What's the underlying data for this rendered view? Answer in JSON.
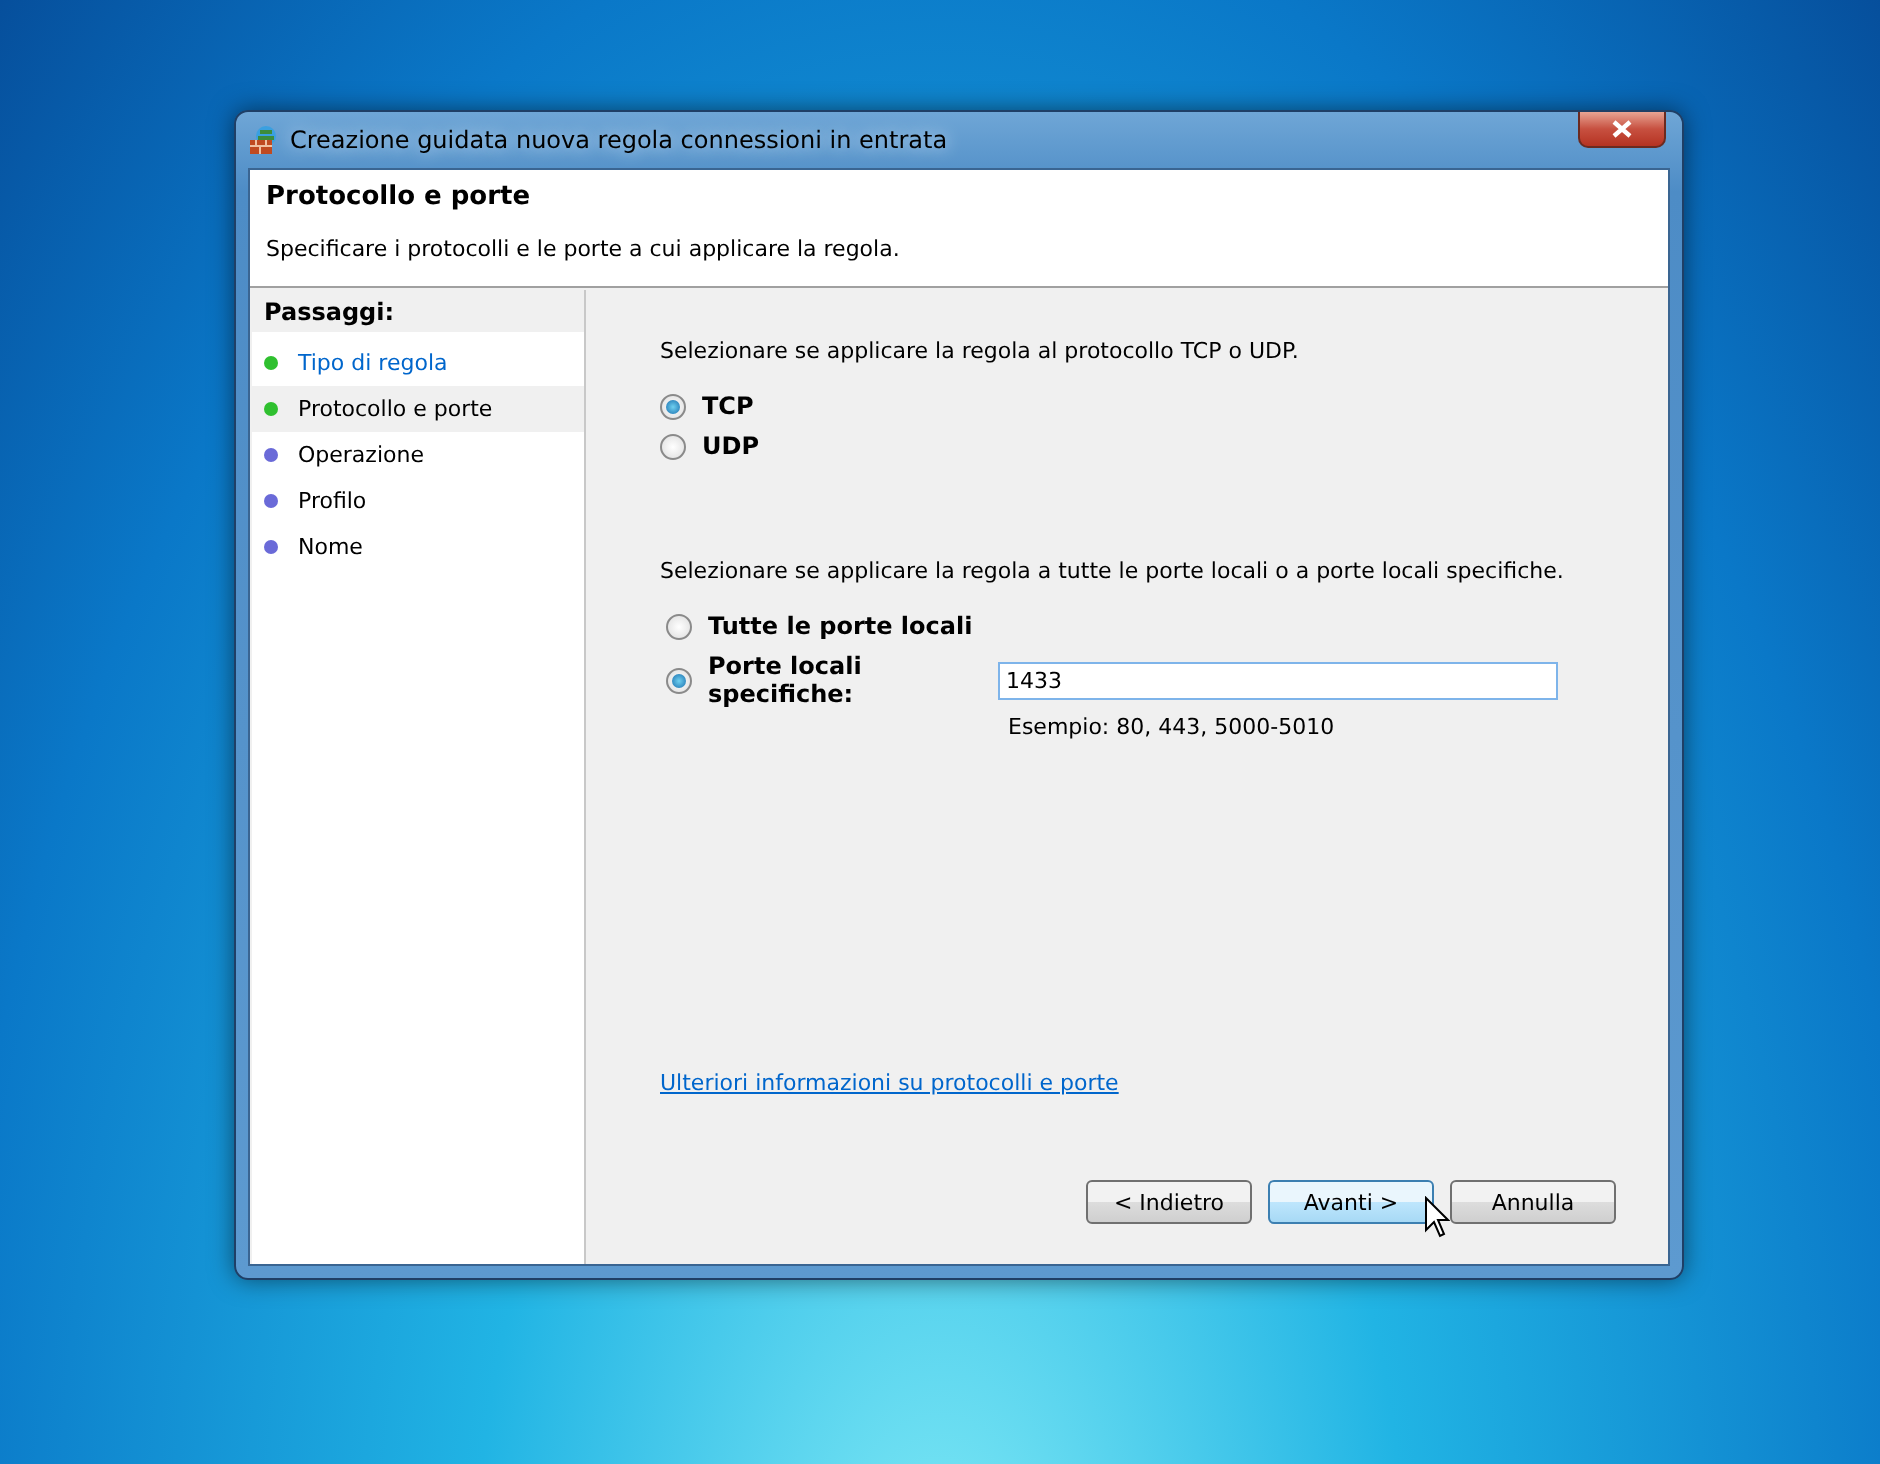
{
  "window": {
    "title": "Creazione guidata nuova regola connessioni in entrata"
  },
  "header": {
    "title": "Protocollo e porte",
    "subtitle": "Specificare i protocolli e le porte a cui applicare la regola."
  },
  "steps": {
    "title": "Passaggi:",
    "items": [
      {
        "label": "Tipo di regola",
        "kind": "link",
        "color": "#2fc02f",
        "selected": false
      },
      {
        "label": "Protocollo e porte",
        "kind": "plain",
        "color": "#2fc02f",
        "selected": true
      },
      {
        "label": "Operazione",
        "kind": "plain",
        "color": "#6a6ad8",
        "selected": false
      },
      {
        "label": "Profilo",
        "kind": "plain",
        "color": "#6a6ad8",
        "selected": false
      },
      {
        "label": "Nome",
        "kind": "plain",
        "color": "#6a6ad8",
        "selected": false
      }
    ]
  },
  "protocol": {
    "prompt": "Selezionare se applicare la regola al protocollo TCP o UDP.",
    "options": [
      {
        "label": "TCP",
        "selected": true
      },
      {
        "label": "UDP",
        "selected": false
      }
    ]
  },
  "ports": {
    "prompt": "Selezionare se applicare la regola a tutte le porte locali o a porte locali specifiche.",
    "options": [
      {
        "label": "Tutte le porte locali",
        "selected": false
      },
      {
        "label": "Porte locali specifiche:",
        "selected": true
      }
    ],
    "value": "1433",
    "example": "Esempio: 80, 443, 5000-5010"
  },
  "help_link": "Ulteriori informazioni su protocolli e porte",
  "buttons": [
    {
      "label": "< Indietro",
      "hovered": false
    },
    {
      "label": "Avanti >",
      "hovered": true
    },
    {
      "label": "Annulla",
      "hovered": false
    }
  ]
}
